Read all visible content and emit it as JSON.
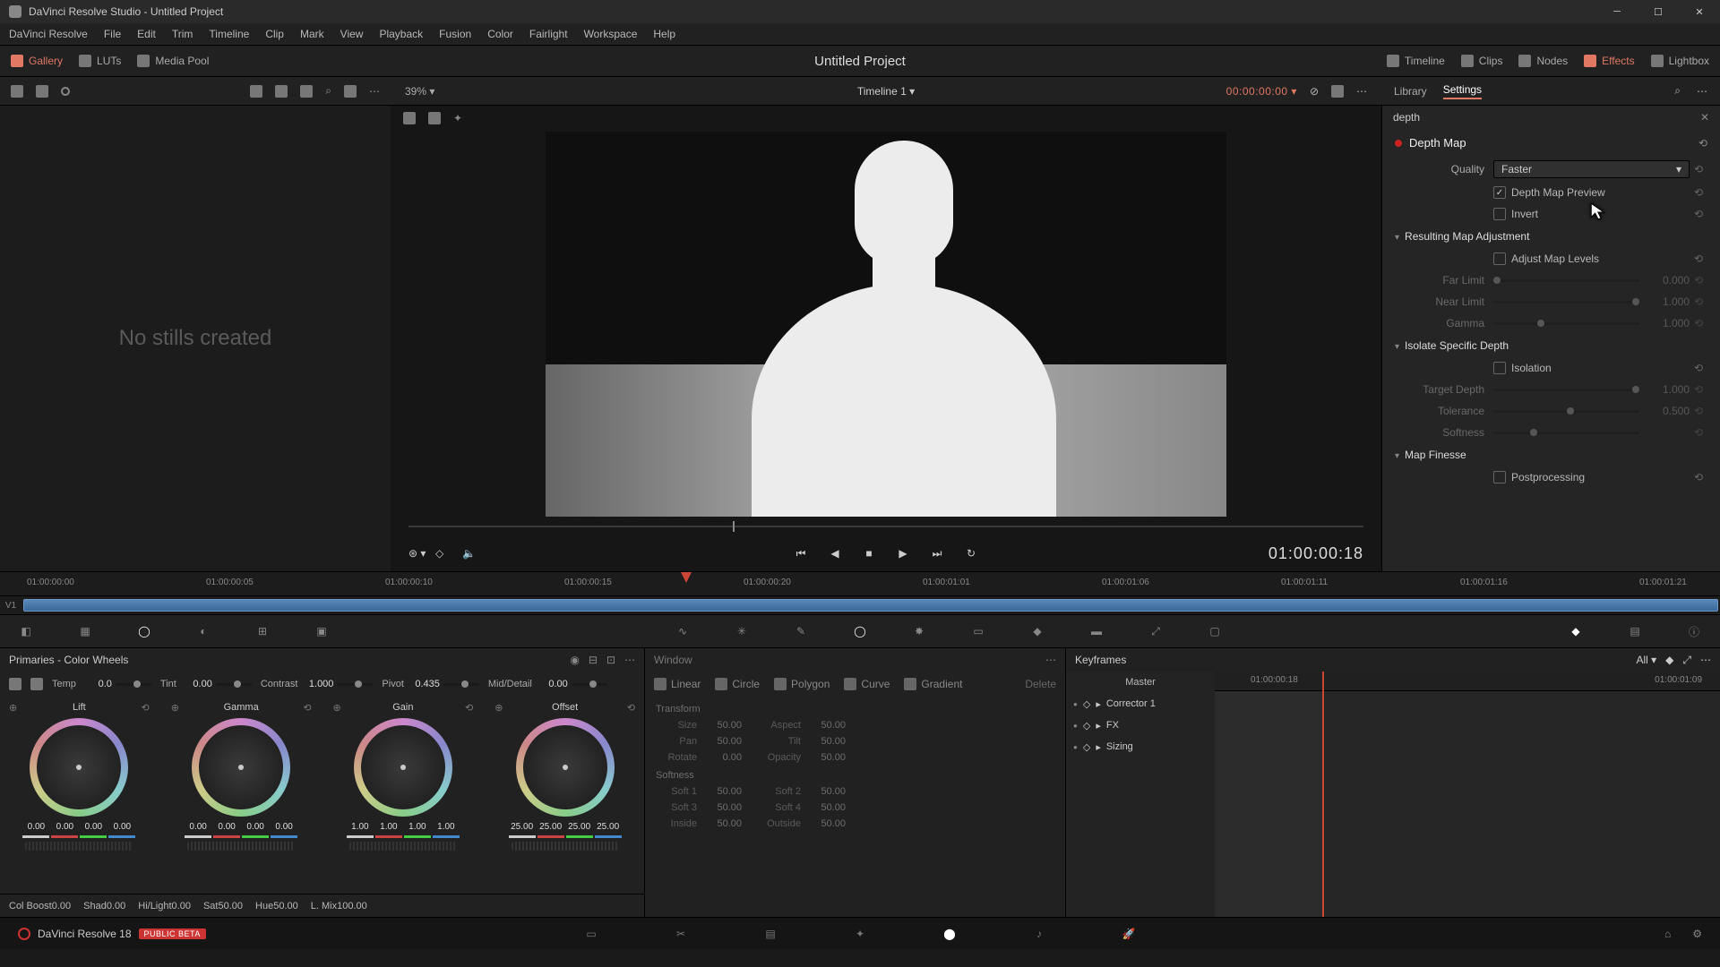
{
  "window": {
    "title": "DaVinci Resolve Studio - Untitled Project"
  },
  "menubar": [
    "DaVinci Resolve",
    "File",
    "Edit",
    "Trim",
    "Timeline",
    "Clip",
    "Mark",
    "View",
    "Playback",
    "Fusion",
    "Color",
    "Fairlight",
    "Workspace",
    "Help"
  ],
  "toolbar": {
    "gallery": "Gallery",
    "luts": "LUTs",
    "mediapool": "Media Pool",
    "project": "Untitled Project",
    "timeline": "Timeline",
    "clips": "Clips",
    "nodes": "Nodes",
    "effects": "Effects",
    "lightbox": "Lightbox"
  },
  "subbar": {
    "zoom": "39%",
    "timeline_name": "Timeline 1",
    "timecode": "00:00:00:00",
    "tab_library": "Library",
    "tab_settings": "Settings"
  },
  "gallery": {
    "empty_text": "No stills created"
  },
  "viewer": {
    "timecode": "01:00:00:18"
  },
  "inspector": {
    "search_value": "depth",
    "effect_name": "Depth Map",
    "quality_label": "Quality",
    "quality_value": "Faster",
    "preview_label": "Depth Map Preview",
    "invert_label": "Invert",
    "section_map_adj": "Resulting Map Adjustment",
    "adjust_levels_label": "Adjust Map Levels",
    "far_limit_label": "Far Limit",
    "far_limit_val": "0.000",
    "near_limit_label": "Near Limit",
    "near_limit_val": "1.000",
    "gamma_label": "Gamma",
    "gamma_val": "1.000",
    "section_isolate": "Isolate Specific Depth",
    "isolation_label": "Isolation",
    "target_depth_label": "Target Depth",
    "target_depth_val": "1.000",
    "tolerance_label": "Tolerance",
    "tolerance_val": "0.500",
    "softness_label": "Softness",
    "softness_val": "",
    "section_finesse": "Map Finesse",
    "postproc_label": "Postprocessing"
  },
  "ruler_ticks": [
    "01:00:00:00",
    "01:00:00:05",
    "01:00:00:10",
    "01:00:00:15",
    "01:00:00:20",
    "01:00:01:01",
    "01:00:01:06",
    "01:00:01:11",
    "01:00:01:16",
    "01:00:01:21"
  ],
  "track_label": "V1",
  "wheels": {
    "title": "Primaries - Color Wheels",
    "adjust_top": [
      {
        "l": "Temp",
        "v": "0.0"
      },
      {
        "l": "Tint",
        "v": "0.00"
      },
      {
        "l": "Contrast",
        "v": "1.000"
      },
      {
        "l": "Pivot",
        "v": "0.435"
      },
      {
        "l": "Mid/Detail",
        "v": "0.00"
      }
    ],
    "cols": [
      {
        "name": "Lift",
        "nums": [
          "0.00",
          "0.00",
          "0.00",
          "0.00"
        ]
      },
      {
        "name": "Gamma",
        "nums": [
          "0.00",
          "0.00",
          "0.00",
          "0.00"
        ]
      },
      {
        "name": "Gain",
        "nums": [
          "1.00",
          "1.00",
          "1.00",
          "1.00"
        ]
      },
      {
        "name": "Offset",
        "nums": [
          "25.00",
          "25.00",
          "25.00",
          "25.00"
        ]
      }
    ],
    "adjust_bottom": [
      {
        "l": "Col Boost",
        "v": "0.00"
      },
      {
        "l": "Shad",
        "v": "0.00"
      },
      {
        "l": "Hi/Light",
        "v": "0.00"
      },
      {
        "l": "Sat",
        "v": "50.00"
      },
      {
        "l": "Hue",
        "v": "50.00"
      },
      {
        "l": "L. Mix",
        "v": "100.00"
      }
    ]
  },
  "mid": {
    "header": "Window",
    "shapes": [
      {
        "l": "Linear"
      },
      {
        "l": "Circle"
      },
      {
        "l": "Polygon"
      },
      {
        "l": "Curve"
      },
      {
        "l": "Gradient"
      }
    ],
    "delete": "Delete",
    "transform_title": "Transform",
    "tf": [
      [
        {
          "l": "Size",
          "v": "50.00"
        },
        {
          "l": "Aspect",
          "v": "50.00"
        }
      ],
      [
        {
          "l": "Pan",
          "v": "50.00"
        },
        {
          "l": "Tilt",
          "v": "50.00"
        }
      ],
      [
        {
          "l": "Rotate",
          "v": "0.00"
        },
        {
          "l": "Opacity",
          "v": "50.00"
        }
      ]
    ],
    "softness_title": "Softness",
    "sf": [
      [
        {
          "l": "Soft 1",
          "v": "50.00"
        },
        {
          "l": "Soft 2",
          "v": "50.00"
        }
      ],
      [
        {
          "l": "Soft 3",
          "v": "50.00"
        },
        {
          "l": "Soft 4",
          "v": "50.00"
        }
      ],
      [
        {
          "l": "Inside",
          "v": "50.00"
        },
        {
          "l": "Outside",
          "v": "50.00"
        }
      ]
    ]
  },
  "keyframes": {
    "title": "Keyframes",
    "filter": "All",
    "ruler": [
      "01:00:00:18",
      "01:00:01:09"
    ],
    "rows": [
      "Master",
      "Corrector 1",
      "FX",
      "Sizing"
    ]
  },
  "footer": {
    "app": "DaVinci Resolve 18",
    "beta": "PUBLIC BETA"
  }
}
